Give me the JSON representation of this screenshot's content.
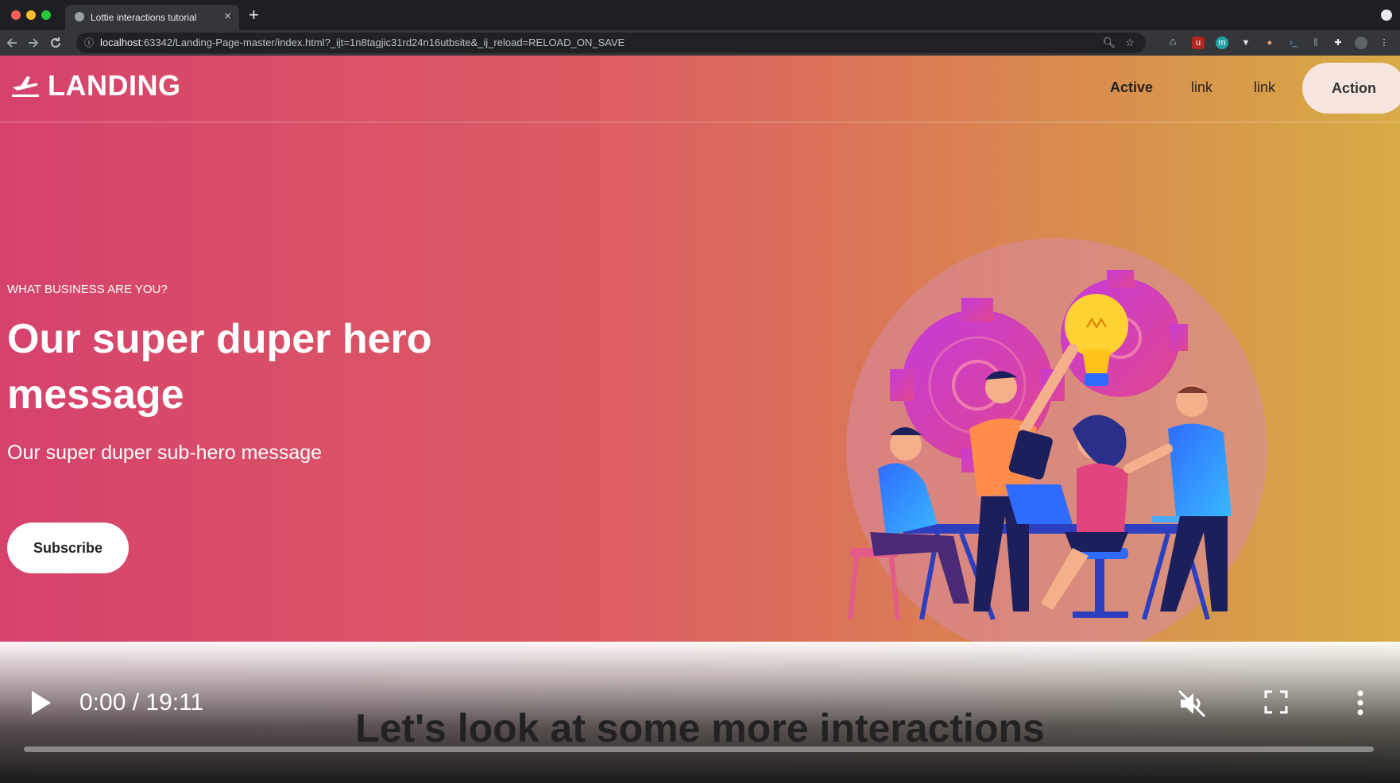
{
  "browser": {
    "tab_title": "Lottie interactions tutorial",
    "tab_close": "×",
    "new_tab": "+",
    "url_host": "localhost",
    "url_rest": ":63342/Landing-Page-master/index.html?_ijt=1n8tagjic31rd24n16utbsite&_ij_reload=RELOAD_ON_SAVE",
    "icons": [
      "back-icon",
      "forward-icon",
      "reload-icon",
      "info-icon",
      "zoom-icon",
      "star-icon",
      "extensions-icon"
    ]
  },
  "site": {
    "brand": "LANDING",
    "nav": {
      "active": "Active",
      "link1": "link",
      "link2": "link",
      "action": "Action"
    },
    "hero": {
      "eyebrow": "WHAT BUSINESS ARE YOU?",
      "title": "Our super duper hero message",
      "subtitle": "Our super duper sub-hero message",
      "cta": "Subscribe"
    },
    "colors": {
      "gradient_start": "#d6426c",
      "gradient_end": "#d7ab46"
    }
  },
  "video": {
    "timecode": "0:00 / 19:11",
    "caption": "Let's look at some more interactions",
    "progress": 0,
    "muted": true
  }
}
